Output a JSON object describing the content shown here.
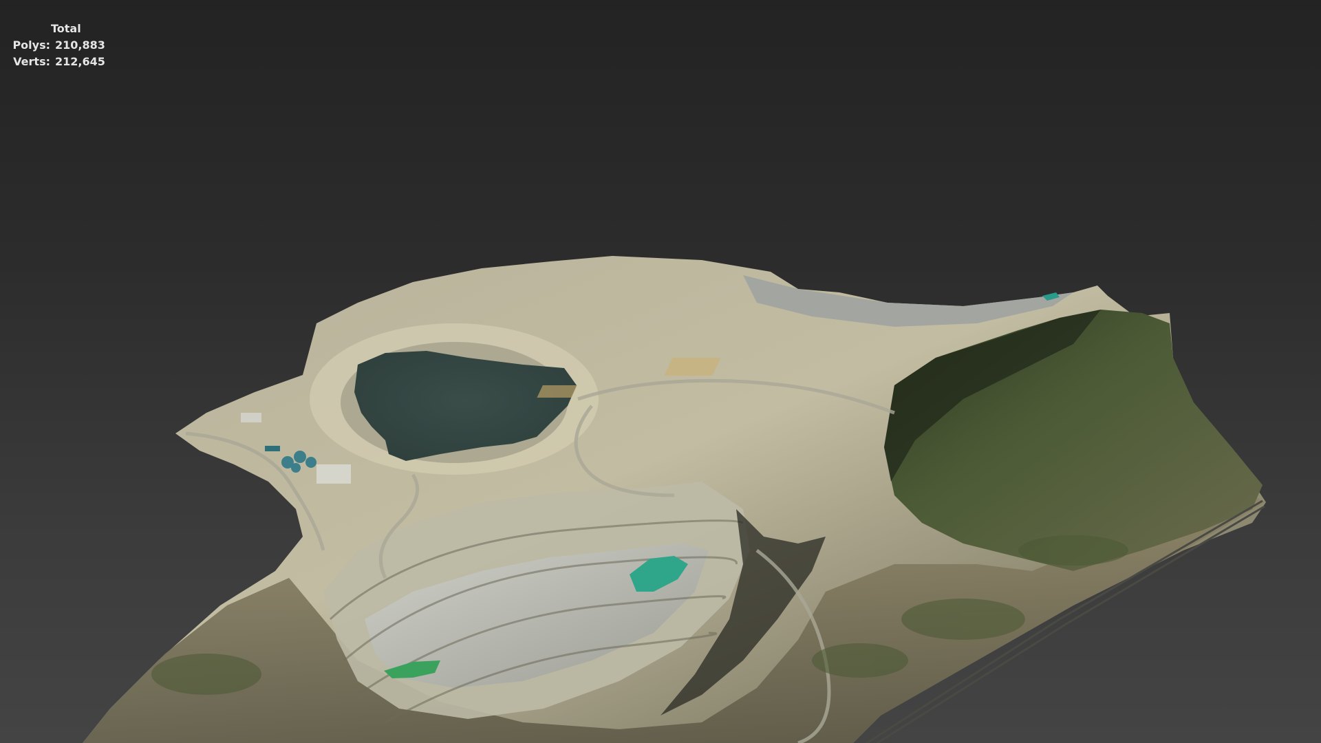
{
  "stats": {
    "header": "Total",
    "polys_label": "Polys:",
    "polys_value": "210,883",
    "verts_label": "Verts:",
    "verts_value": "212,645"
  },
  "colors": {
    "background_top": "#232323",
    "background_bottom": "#444444",
    "stats_text": "#e6e6e6",
    "pit_lake": "#364845",
    "green_pond": "#2fa58a",
    "vegetation": "#3d4a2c",
    "rock": "#b9b29a"
  },
  "scene": {
    "object": "open-pit-mine-terrain-mesh"
  }
}
